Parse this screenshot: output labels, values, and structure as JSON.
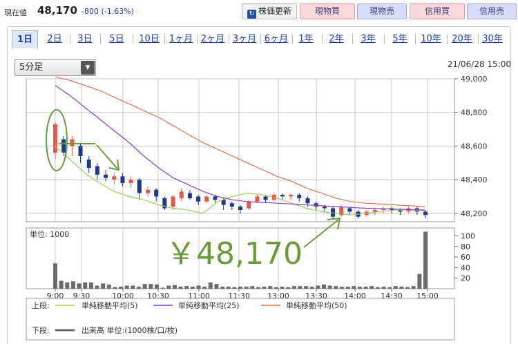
{
  "quote": {
    "label": "現在値",
    "price": "48,170",
    "change": "-800 (-1.63%)"
  },
  "buttons": {
    "refresh": "株価更新",
    "spot_buy": "現物買",
    "spot_sell": "現物売",
    "margin_buy": "信用買",
    "margin_sell": "信用売"
  },
  "tabs": [
    "1日",
    "2日",
    "3日",
    "5日",
    "10日",
    "1ヶ月",
    "2ヶ月",
    "3ヶ月",
    "6ヶ月",
    "1年",
    "2年",
    "3年",
    "5年",
    "10年",
    "20年",
    "30年"
  ],
  "interval_select": "5分足",
  "datetime": "21/06/28 15:00",
  "colors": {
    "up": "#e05a50",
    "down": "#1f3a8a",
    "ma5": "#9acd55",
    "ma25": "#8a3fd1",
    "ma50": "#e0704a",
    "annotation": "#6a9a3c",
    "volume": "#6b6b6b"
  },
  "annotation": "￥48,170",
  "legend": {
    "upper_label": "上段:",
    "lower_label": "下段:",
    "items": [
      "単純移動平均(5)",
      "単純移動平均(25)",
      "単純移動平均(50)"
    ],
    "volume_item": "出来高 単位:(1000株/口/枚)"
  },
  "chart_data": [
    {
      "type": "candlestick",
      "x_ticks": [
        "9:00",
        "9:30",
        "10:00",
        "10:30",
        "11:00",
        "11:30",
        "13:00",
        "13:30",
        "14:00",
        "14:30",
        "15:00"
      ],
      "y_ticks": [
        "49,000",
        "48,800",
        "48,600",
        "48,400",
        "48,200"
      ],
      "ylim": [
        48150,
        49000
      ],
      "series": [
        {
          "name": "単純移動平均(5)",
          "values": [
            48600,
            48520,
            48440,
            48380,
            48330,
            48300,
            48280,
            48250,
            48230,
            48220,
            48200,
            48270,
            48300,
            48320,
            48310,
            48290,
            48260,
            48230,
            48210,
            48200,
            48190,
            48200,
            48210,
            48220,
            48220,
            48215
          ]
        },
        {
          "name": "単純移動平均(25)",
          "values": [
            48960,
            48900,
            48830,
            48760,
            48690,
            48620,
            48540,
            48470,
            48410,
            48370,
            48330,
            48300,
            48280,
            48270,
            48265,
            48260,
            48255,
            48250,
            48245,
            48240,
            48235,
            48230,
            48228,
            48225,
            48222,
            48220
          ]
        },
        {
          "name": "単純移動平均(50)",
          "values": [
            49010,
            48990,
            48960,
            48930,
            48890,
            48850,
            48810,
            48770,
            48720,
            48670,
            48620,
            48580,
            48540,
            48500,
            48460,
            48420,
            48390,
            48350,
            48320,
            48290,
            48270,
            48260,
            48255,
            48250,
            48245,
            48240
          ]
        }
      ]
    },
    {
      "type": "bar",
      "title": "単位: 1000",
      "y_ticks": [
        "100",
        "80",
        "60",
        "40",
        "20"
      ],
      "ylim": [
        0,
        115
      ],
      "values": [
        48,
        15,
        12,
        14,
        10,
        12,
        12,
        6,
        10,
        8,
        3,
        4,
        6,
        6,
        4,
        9,
        9,
        8,
        2,
        6,
        7,
        4,
        5,
        4,
        6,
        4,
        12,
        9,
        4,
        4,
        3,
        4,
        4,
        5,
        3,
        4,
        5,
        3,
        4,
        3,
        5,
        5,
        5,
        4,
        6,
        8,
        6,
        5,
        4,
        4,
        5,
        4,
        4,
        5,
        3,
        4,
        3,
        5,
        4,
        3,
        5,
        28,
        108
      ]
    }
  ]
}
